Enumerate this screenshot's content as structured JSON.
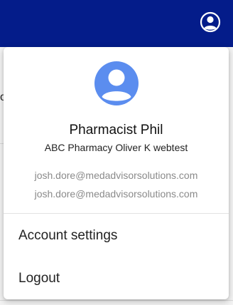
{
  "header": {
    "account_icon": "account-circle-icon",
    "background_color": "#041c8a"
  },
  "background": {
    "partial_text": "o"
  },
  "profile_menu": {
    "avatar_icon": "person-avatar-icon",
    "avatar_color": "#5b8def",
    "user_name": "Pharmacist Phil",
    "pharmacy_name": "ABC Pharmacy Oliver K webtest",
    "emails": [
      "josh.dore@medadvisorsolutions.com",
      "josh.dore@medadvisorsolutions.com"
    ],
    "items": [
      {
        "label": "Account settings"
      },
      {
        "label": "Logout"
      }
    ]
  }
}
